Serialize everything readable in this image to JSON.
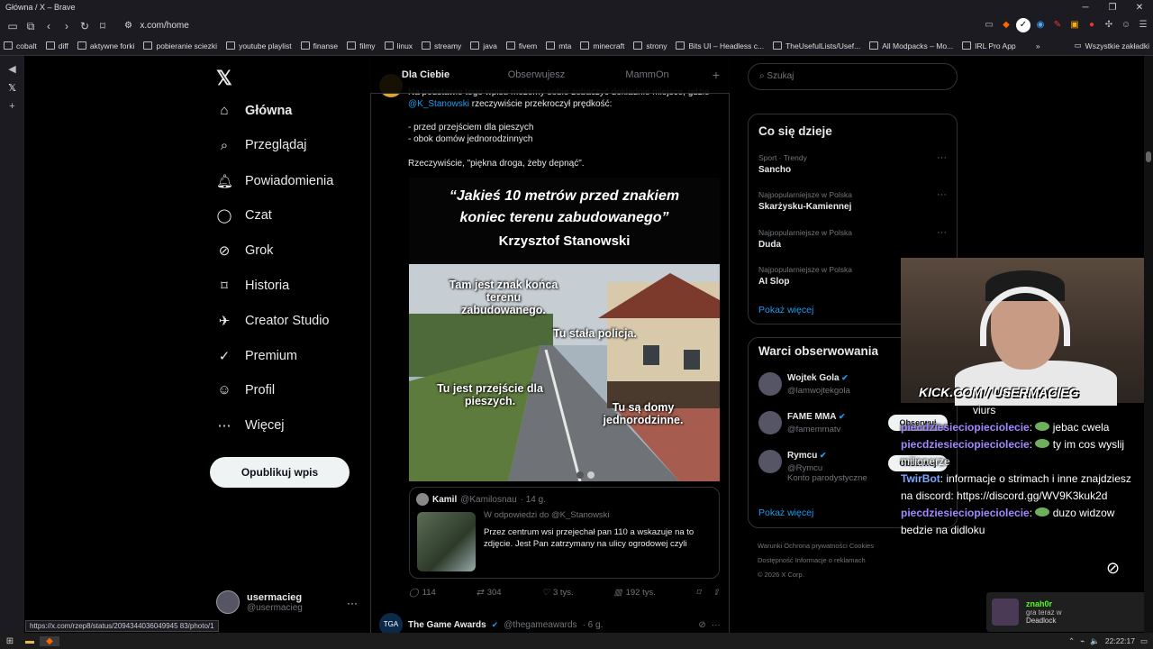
{
  "window": {
    "title": "Główna / X – Brave"
  },
  "browser": {
    "url": "x.com/home",
    "bookmarks": [
      "cobalt",
      "diff",
      "aktywne forki",
      "pobieranie sciezki",
      "youtube playlist",
      "finanse",
      "filmy",
      "linux",
      "streamy",
      "java",
      "fivem",
      "mta",
      "minecraft",
      "strony",
      "Bits UI – Headless c...",
      "TheUsefulLists/Usef...",
      "All Modpacks – Mo...",
      "IRL Pro App"
    ],
    "bookmarks_more": "»",
    "other_bookmarks": "Wszystkie zakładki",
    "status_link": "https://x.com/rzep8/status/2094344036049945 83/photo/1"
  },
  "nav": {
    "items": [
      "Główna",
      "Przeglądaj",
      "Powiadomienia",
      "Czat",
      "Grok",
      "Historia",
      "Creator Studio",
      "Premium",
      "Profil",
      "Więcej"
    ],
    "post_button": "Opublikuj wpis",
    "profile_name": "usermacieg",
    "profile_handle": "@usermacieg"
  },
  "tabs": [
    "Dla Ciebie",
    "Obserwujesz",
    "MammOn"
  ],
  "post": {
    "line1": "Na podstawie tego wpisu możemy sobie zobaczyć dokładnie miejsce, gdzie",
    "mention": "@K_Stanowski",
    "line2": " rzeczywiście przekroczył prędkość:",
    "bullet1": "- przed przejściem dla pieszych",
    "bullet2": "- obok domów jednorodzinnych",
    "line3": "Rzeczywiście, \"piękna droga, żeby depnąć\".",
    "quote_line1": "“Jakieś 10 metrów przed znakiem",
    "quote_line2": "koniec terenu zabudowanego”",
    "quote_author": "Krzysztof Stanowski",
    "overlay1": "Tam jest znak końca terenu zabudowanego.",
    "overlay2": "Tu stała policja.",
    "overlay3": "Tu jest przejście dla pieszych.",
    "overlay4": "Tu są domy jednorodzinne.",
    "replies": "114",
    "reposts": "304",
    "likes": "3 tys.",
    "views": "192 tys."
  },
  "quoted_reply": {
    "name": "Kamil",
    "handle": "@Kamilosnau",
    "time": "· 14 g.",
    "reply_to": "W odpowiedzi do @K_Stanowski",
    "text": "Przez centrum wsi przejechał pan 110 a wskazuje na to zdjęcie. Jest Pan zatrzymany na ulicy ogrodowej czyli"
  },
  "next_post": {
    "name": "The Game Awards",
    "handle": "@thegameawards",
    "time": "· 6 g."
  },
  "search": {
    "placeholder": "Szukaj"
  },
  "trending": {
    "title": "Co się dzieje",
    "items": [
      {
        "category": "Sport · Trendy",
        "name": "Sancho"
      },
      {
        "category": "Najpopularniejsze w Polska",
        "name": "Skarżysku-Kamiennej"
      },
      {
        "category": "Najpopularniejsze w Polska",
        "name": "Duda"
      },
      {
        "category": "Najpopularniejsze w Polska",
        "name": "AI Slop"
      }
    ],
    "show_more": "Pokaż więcej"
  },
  "who_to_follow": {
    "title": "Warci obserwowania",
    "items": [
      {
        "name": "Wojtek Gola",
        "handle": "@lamwojtekgola",
        "button": "",
        "extra": ""
      },
      {
        "name": "FAME MMA",
        "handle": "@famemmatv",
        "button": "Obserwuj",
        "extra": ""
      },
      {
        "name": "Rymcu",
        "handle": "@Rymcu",
        "button": "Obserwuj",
        "extra": "Konto parodystyczne"
      }
    ],
    "show_more": "Pokaż więcej"
  },
  "footer": {
    "links": "Warunki   Ochrona prywatności   Cookies",
    "links2": "Dostępność   Informacje o reklamach",
    "copyright": "© 2026 X Corp."
  },
  "stream": {
    "kick": "KICK.COM / USERMACIEG",
    "chat": [
      {
        "user": "",
        "text": "viurs"
      },
      {
        "user": "piecdziesieciopieciolecie",
        "text": "jebac cwela"
      },
      {
        "user": "piecdziesieciopieciolecie",
        "text": "ty im cos wyslij milionerze"
      },
      {
        "user": "TwirBot",
        "text": "informacje o strimach i inne znajdziesz na discord: https://discord.gg/WV9K3kuk2d"
      },
      {
        "user": "piecdziesieciopieciolecie",
        "text": "duzo widzow bedzie na didloku"
      }
    ],
    "notif_user": "znah0r",
    "notif_line1": "gra teraz w",
    "notif_game": "Deadlock"
  },
  "taskbar": {
    "time": "22:22:17"
  }
}
